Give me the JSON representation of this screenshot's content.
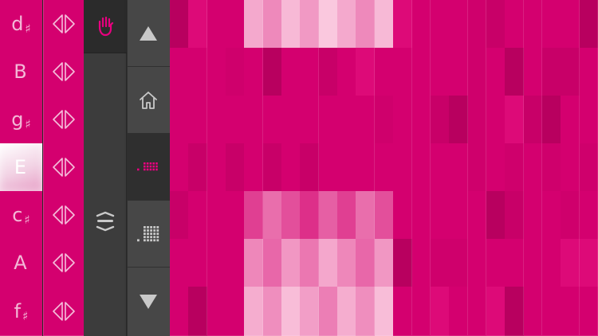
{
  "notes": [
    {
      "letter": "d",
      "accidental": "♯",
      "active": false
    },
    {
      "letter": "B",
      "accidental": "",
      "active": false
    },
    {
      "letter": "g",
      "accidental": "♯",
      "active": false
    },
    {
      "letter": "E",
      "accidental": "",
      "active": true
    },
    {
      "letter": "c",
      "accidental": "♯",
      "active": false
    },
    {
      "letter": "A",
      "accidental": "",
      "active": false
    },
    {
      "letter": "f",
      "accidental": "♯",
      "active": false
    }
  ],
  "colors": {
    "accent": "#e8007f",
    "pad_base": "#d4006f",
    "panel_dark": "#2b2b2b",
    "panel_mid": "#3c3c3c",
    "nav_bg": "#474747",
    "icon_light": "#c9c9c9"
  },
  "tools": {
    "hand_icon": "hand-icon",
    "menu_icon": "stack-menu-icon"
  },
  "nav": [
    {
      "icon": "triangle-up-icon"
    },
    {
      "icon": "home-icon"
    },
    {
      "icon": "small-grid-icon",
      "selected": true
    },
    {
      "icon": "large-grid-icon"
    },
    {
      "icon": "triangle-down-icon"
    }
  ],
  "grid": {
    "columns": 23,
    "rows": 7,
    "highlights": [
      {
        "row": 0,
        "from": 4,
        "to": 11,
        "level": 0.75
      },
      {
        "row": 4,
        "from": 4,
        "to": 11,
        "level": 0.35
      },
      {
        "row": 5,
        "from": 4,
        "to": 11,
        "level": 0.6
      },
      {
        "row": 6,
        "from": 4,
        "to": 11,
        "level": 0.7
      }
    ]
  }
}
